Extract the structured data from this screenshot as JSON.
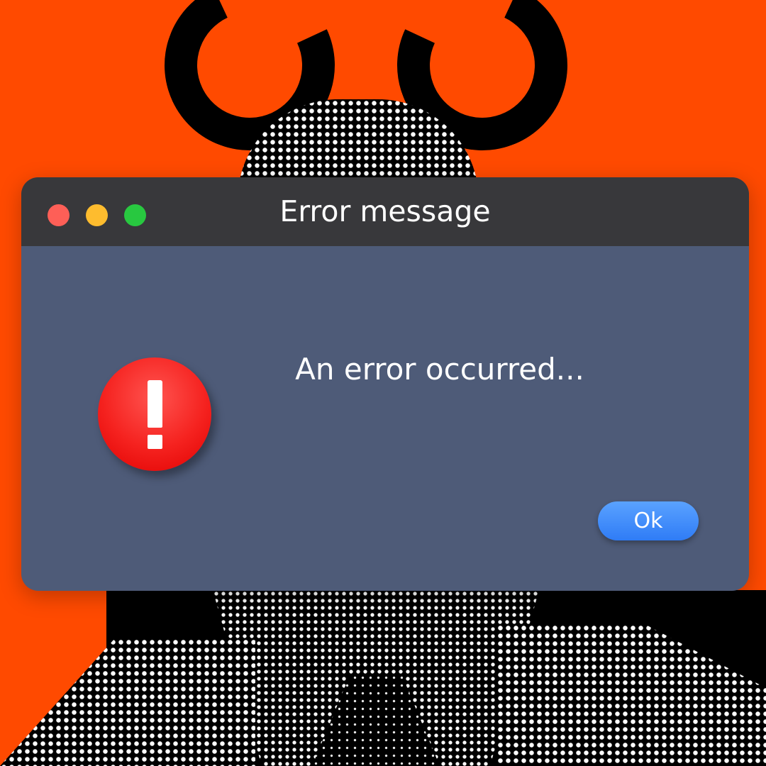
{
  "dialog": {
    "title": "Error message",
    "message": "An error occurred...",
    "ok_label": "Ok",
    "icon": "alert-exclamation-icon"
  },
  "window_controls": [
    "close-button",
    "minimize-button",
    "maximize-button"
  ],
  "colors": {
    "background": "#ff4a00",
    "titlebar": "#38383b",
    "window_body": "#4e5b78",
    "alert": "#f5221f",
    "button": "#3d8bfa",
    "close": "#fe5f57",
    "minimize": "#febc2e",
    "maximize": "#28c840"
  }
}
